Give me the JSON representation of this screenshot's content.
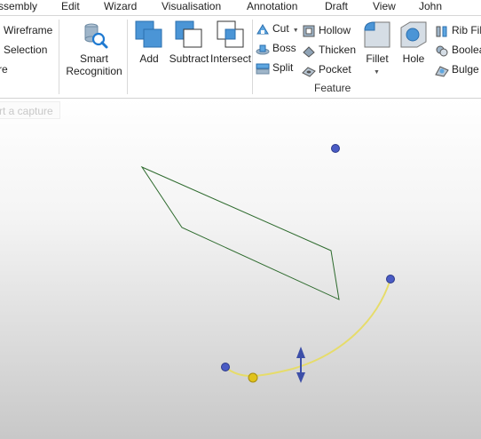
{
  "menu": {
    "items": [
      "ssembly",
      "Edit",
      "Wizard",
      "Visualisation",
      "Annotation",
      "Draft",
      "View",
      "John"
    ]
  },
  "ribbon": {
    "left_column": [
      "Wireframe",
      "Selection",
      "re"
    ],
    "smart_recognition": {
      "line1": "Smart",
      "line2": "Recognition"
    },
    "add_label": "Add",
    "subtract_label": "Subtract",
    "intersect_label": "Intersect",
    "cut_label": "Cut",
    "boss_label": "Boss",
    "split_label": "Split",
    "hollow_label": "Hollow",
    "thicken_label": "Thicken",
    "pocket_label": "Pocket",
    "fillet_label": "Fillet",
    "hole_label": "Hole",
    "rib_label": "Rib Fil",
    "boolean_label": "Boolea",
    "bulge_label": "Bulge",
    "feature_group_label": "Feature"
  },
  "viewport": {
    "capture_hint": "rt a capture",
    "colors": {
      "polygon_stroke": "#2e6b2e",
      "curve_stroke": "#e6dc6a",
      "control_point": "#4a5bc4",
      "manipulator_arrow": "#3d4fa8",
      "curve_handle": "#e0c21a"
    }
  }
}
